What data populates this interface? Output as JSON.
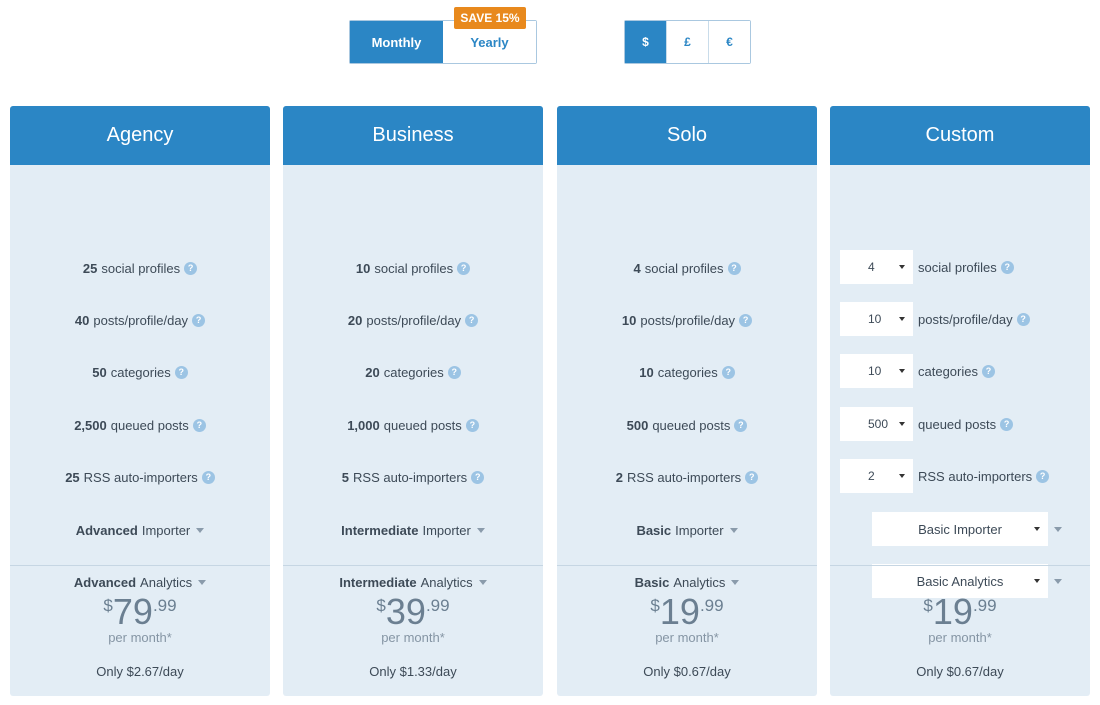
{
  "billing": {
    "monthly": "Monthly",
    "yearly": "Yearly",
    "badge": "SAVE 15%",
    "selected": "Monthly"
  },
  "currency": {
    "options": [
      "$",
      "£",
      "€"
    ],
    "selected": "$"
  },
  "plans": [
    {
      "name": "Agency",
      "features": [
        {
          "bold": "25",
          "text": "social profiles"
        },
        {
          "bold": "40",
          "text": "posts/profile/day"
        },
        {
          "bold": "50",
          "text": "categories"
        },
        {
          "bold": "2,500",
          "text": "queued posts"
        },
        {
          "bold": "25",
          "text": "RSS auto-importers"
        },
        {
          "bold": "Advanced",
          "text": "Importer"
        },
        {
          "bold": "Advanced",
          "text": "Analytics"
        }
      ],
      "price": {
        "currency": "$",
        "whole": "79",
        "cents": ".99",
        "period": "per month*",
        "per_day": "Only $2.67/day"
      }
    },
    {
      "name": "Business",
      "features": [
        {
          "bold": "10",
          "text": "social profiles"
        },
        {
          "bold": "20",
          "text": "posts/profile/day"
        },
        {
          "bold": "20",
          "text": "categories"
        },
        {
          "bold": "1,000",
          "text": "queued posts"
        },
        {
          "bold": "5",
          "text": "RSS auto-importers"
        },
        {
          "bold": "Intermediate",
          "text": "Importer"
        },
        {
          "bold": "Intermediate",
          "text": "Analytics"
        }
      ],
      "price": {
        "currency": "$",
        "whole": "39",
        "cents": ".99",
        "period": "per month*",
        "per_day": "Only $1.33/day"
      }
    },
    {
      "name": "Solo",
      "features": [
        {
          "bold": "4",
          "text": "social profiles"
        },
        {
          "bold": "10",
          "text": "posts/profile/day"
        },
        {
          "bold": "10",
          "text": "categories"
        },
        {
          "bold": "500",
          "text": "queued posts"
        },
        {
          "bold": "2",
          "text": "RSS auto-importers"
        },
        {
          "bold": "Basic",
          "text": "Importer"
        },
        {
          "bold": "Basic",
          "text": "Analytics"
        }
      ],
      "price": {
        "currency": "$",
        "whole": "19",
        "cents": ".99",
        "period": "per month*",
        "per_day": "Only $0.67/day"
      }
    }
  ],
  "custom": {
    "name": "Custom",
    "selects": [
      {
        "value": "4",
        "text": "social profiles"
      },
      {
        "value": "10",
        "text": "posts/profile/day"
      },
      {
        "value": "10",
        "text": "categories"
      },
      {
        "value": "500",
        "text": "queued posts"
      },
      {
        "value": "2",
        "text": "RSS auto-importers"
      }
    ],
    "importer": "Basic Importer",
    "analytics": "Basic Analytics",
    "price": {
      "currency": "$",
      "whole": "19",
      "cents": ".99",
      "period": "per month*",
      "per_day": "Only $0.67/day"
    }
  },
  "icons": {
    "help": "question-mark-icon",
    "dropdown": "caret-down-icon"
  },
  "colors": {
    "accent": "#2b86c5",
    "card_bg": "#e3edf5",
    "badge": "#e8891d"
  }
}
